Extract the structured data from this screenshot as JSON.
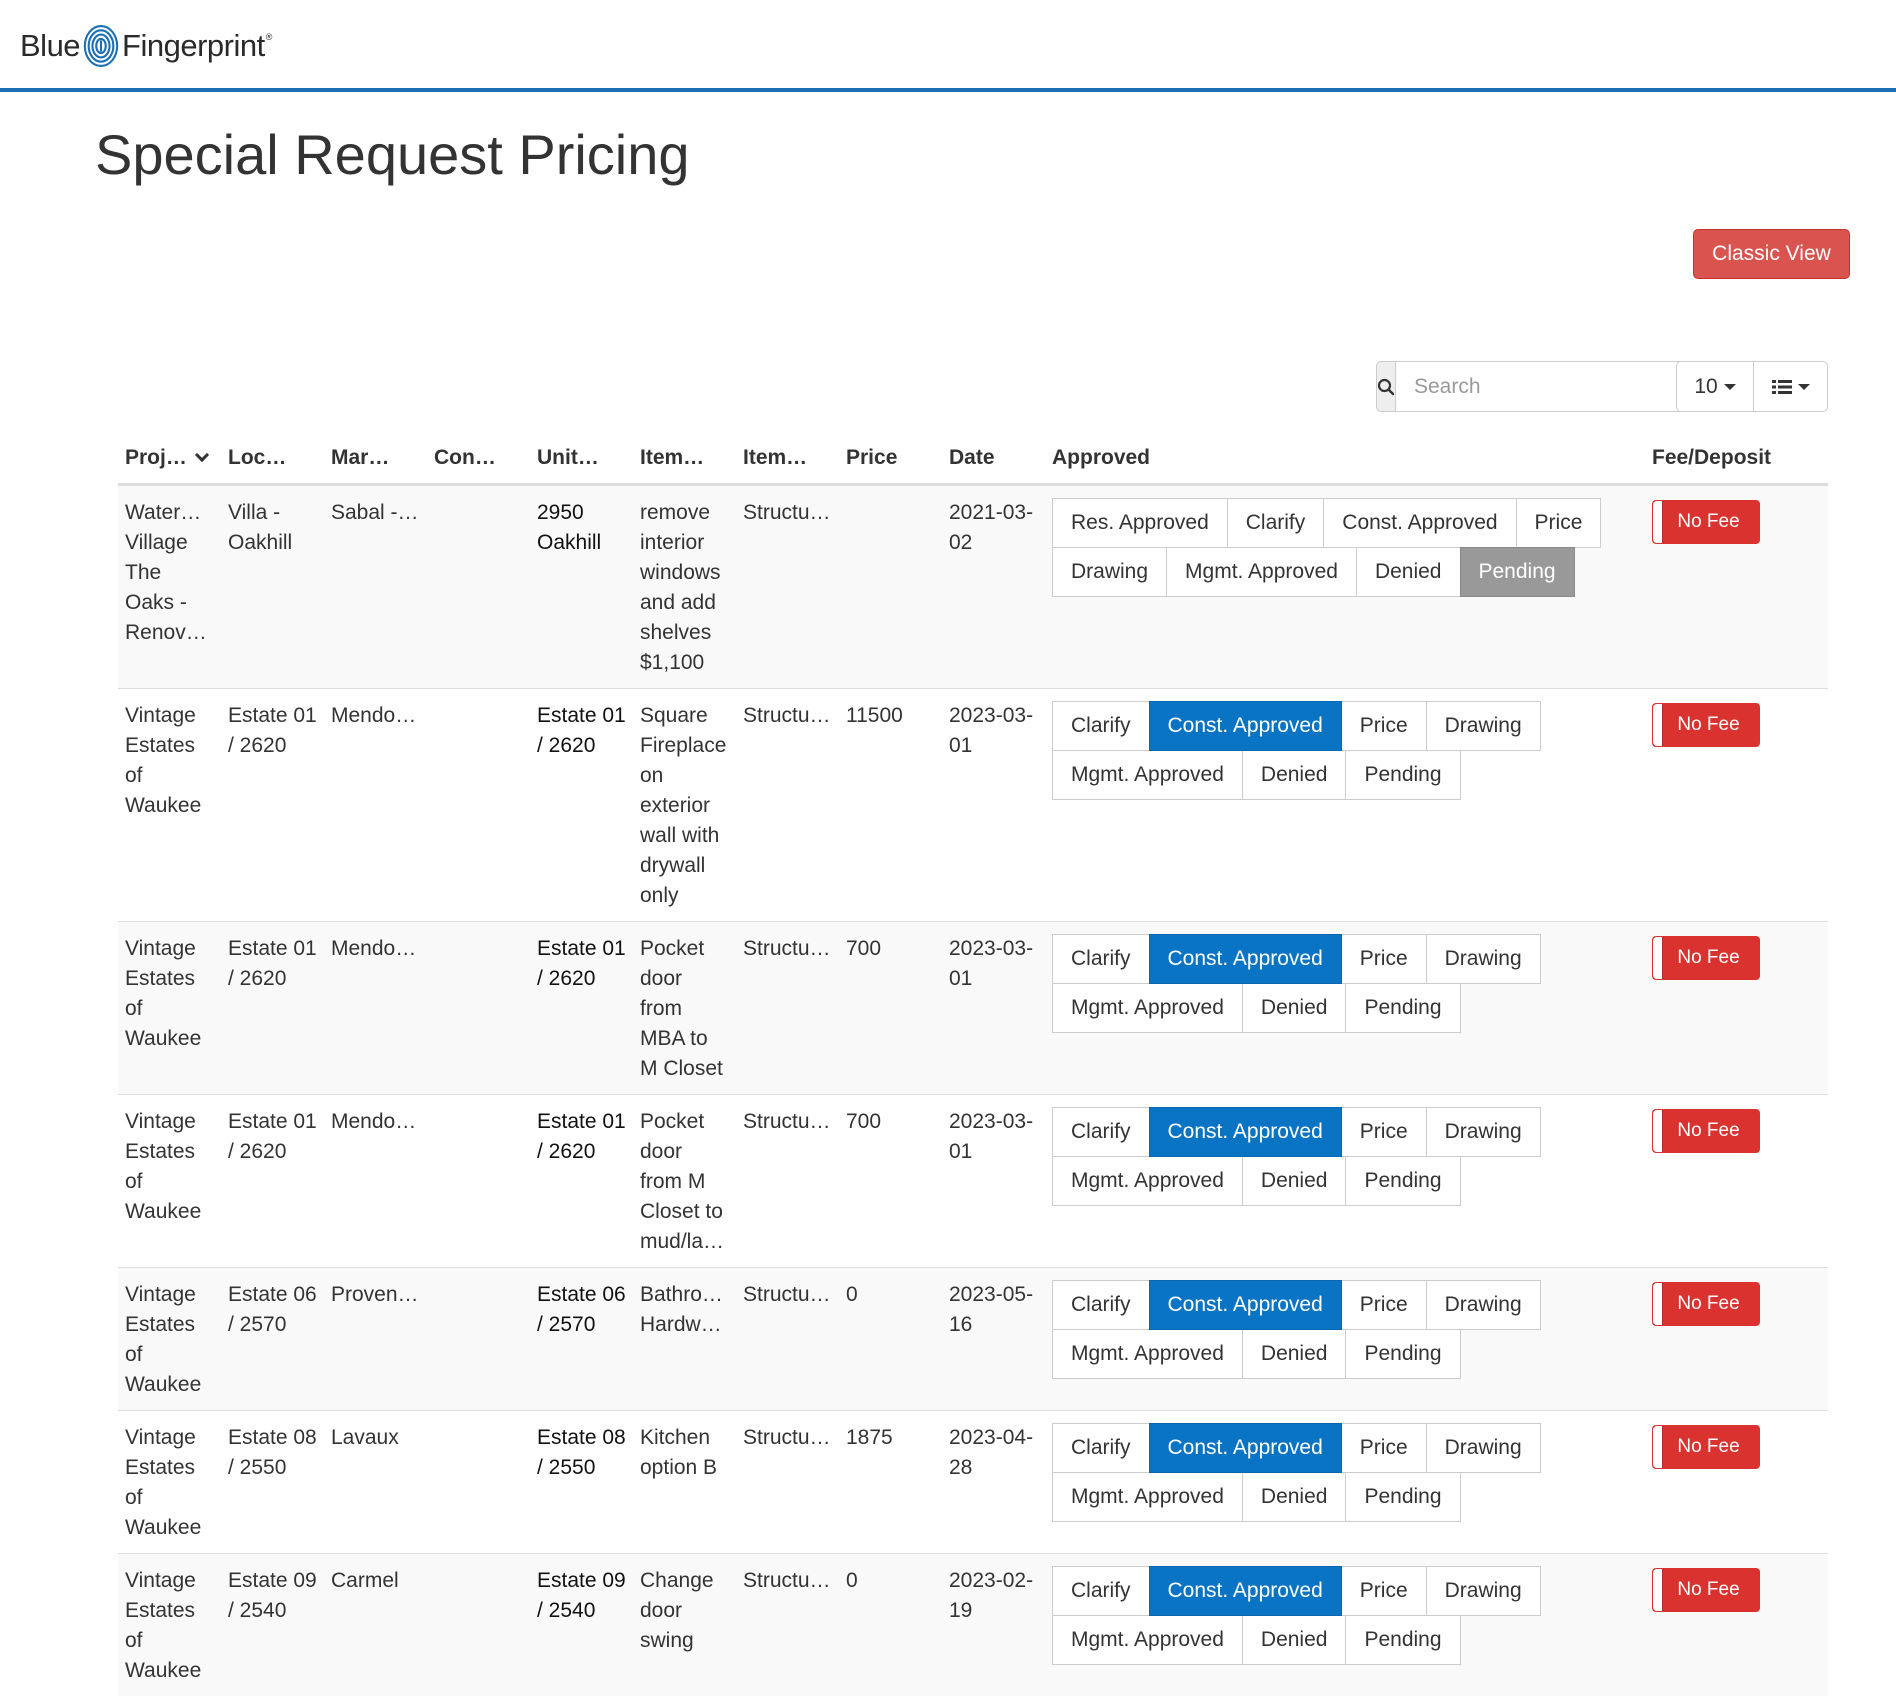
{
  "header": {
    "logo_left": "Blue",
    "logo_right": "Fingerprint",
    "logo_mark": "®"
  },
  "page_title": "Special Request Pricing",
  "classic_view_label": "Classic View",
  "search": {
    "placeholder": "Search",
    "icon": "search-icon"
  },
  "page_size": "10",
  "columns_icon": "list-icon",
  "columns": [
    "Proj…",
    "Loc…",
    "Mar…",
    "Con…",
    "Unit…",
    "Item…",
    "Item…",
    "Price",
    "Date",
    "Approved",
    "Fee/Deposit"
  ],
  "colors": {
    "accent_blue": "#0a74c4",
    "danger_red": "#d9534f",
    "pending_grey": "#999999",
    "header_rule": "#1a6fb5"
  },
  "rows": [
    {
      "project": "Water… Village The Oaks - Renov…",
      "location": "Villa - Oakhill",
      "market": "Sabal - Screen",
      "con": "",
      "unit": "2950 Oakhill",
      "item": "remove interior windows and add shelves $1,100",
      "item_type": "Structu…",
      "price": "",
      "date": "2021-03-02",
      "approvals": [
        "Res. Approved",
        "Clarify",
        "Const. Approved",
        "Price",
        "Drawing",
        "Mgmt. Approved",
        "Denied",
        "Pending"
      ],
      "active": "Pending",
      "fee": "No Fee"
    },
    {
      "project": "Vintage Estates of Waukee",
      "location": "Estate 01 / 2620",
      "market": "Mendo…",
      "con": "",
      "unit": "Estate 01 / 2620",
      "item": "Square Fireplace on exterior wall with drywall only",
      "item_type": "Structu…",
      "price": "11500",
      "date": "2023-03-01",
      "approvals": [
        "Clarify",
        "Const. Approved",
        "Price",
        "Drawing",
        "Mgmt. Approved",
        "Denied",
        "Pending"
      ],
      "active": "Const. Approved",
      "fee": "No Fee"
    },
    {
      "project": "Vintage Estates of Waukee",
      "location": "Estate 01 / 2620",
      "market": "Mendo…",
      "con": "",
      "unit": "Estate 01 / 2620",
      "item": "Pocket door from MBA to M Closet",
      "item_type": "Structu…",
      "price": "700",
      "date": "2023-03-01",
      "approvals": [
        "Clarify",
        "Const. Approved",
        "Price",
        "Drawing",
        "Mgmt. Approved",
        "Denied",
        "Pending"
      ],
      "active": "Const. Approved",
      "fee": "No Fee"
    },
    {
      "project": "Vintage Estates of Waukee",
      "location": "Estate 01 / 2620",
      "market": "Mendo…",
      "con": "",
      "unit": "Estate 01 / 2620",
      "item": "Pocket door from M Closet to mud/la…",
      "item_type": "Structu…",
      "price": "700",
      "date": "2023-03-01",
      "approvals": [
        "Clarify",
        "Const. Approved",
        "Price",
        "Drawing",
        "Mgmt. Approved",
        "Denied",
        "Pending"
      ],
      "active": "Const. Approved",
      "fee": "No Fee"
    },
    {
      "project": "Vintage Estates of Waukee",
      "location": "Estate 06 / 2570",
      "market": "Proven…",
      "con": "",
      "unit": "Estate 06 / 2570",
      "item": "Bathro… Hardw…",
      "item_type": "Structu…",
      "price": "0",
      "date": "2023-05-16",
      "approvals": [
        "Clarify",
        "Const. Approved",
        "Price",
        "Drawing",
        "Mgmt. Approved",
        "Denied",
        "Pending"
      ],
      "active": "Const. Approved",
      "fee": "No Fee"
    },
    {
      "project": "Vintage Estates of Waukee",
      "location": "Estate 08 / 2550",
      "market": "Lavaux",
      "con": "",
      "unit": "Estate 08 / 2550",
      "item": "Kitchen option B",
      "item_type": "Structu…",
      "price": "1875",
      "date": "2023-04-28",
      "approvals": [
        "Clarify",
        "Const. Approved",
        "Price",
        "Drawing",
        "Mgmt. Approved",
        "Denied",
        "Pending"
      ],
      "active": "Const. Approved",
      "fee": "No Fee"
    },
    {
      "project": "Vintage Estates of Waukee",
      "location": "Estate 09 / 2540",
      "market": "Carmel",
      "con": "",
      "unit": "Estate 09 / 2540",
      "item": "Change door swing",
      "item_type": "Structu…",
      "price": "0",
      "date": "2023-02-19",
      "approvals": [
        "Clarify",
        "Const. Approved",
        "Price",
        "Drawing",
        "Mgmt. Approved",
        "Denied",
        "Pending"
      ],
      "active": "Const. Approved",
      "fee": "No Fee"
    }
  ]
}
